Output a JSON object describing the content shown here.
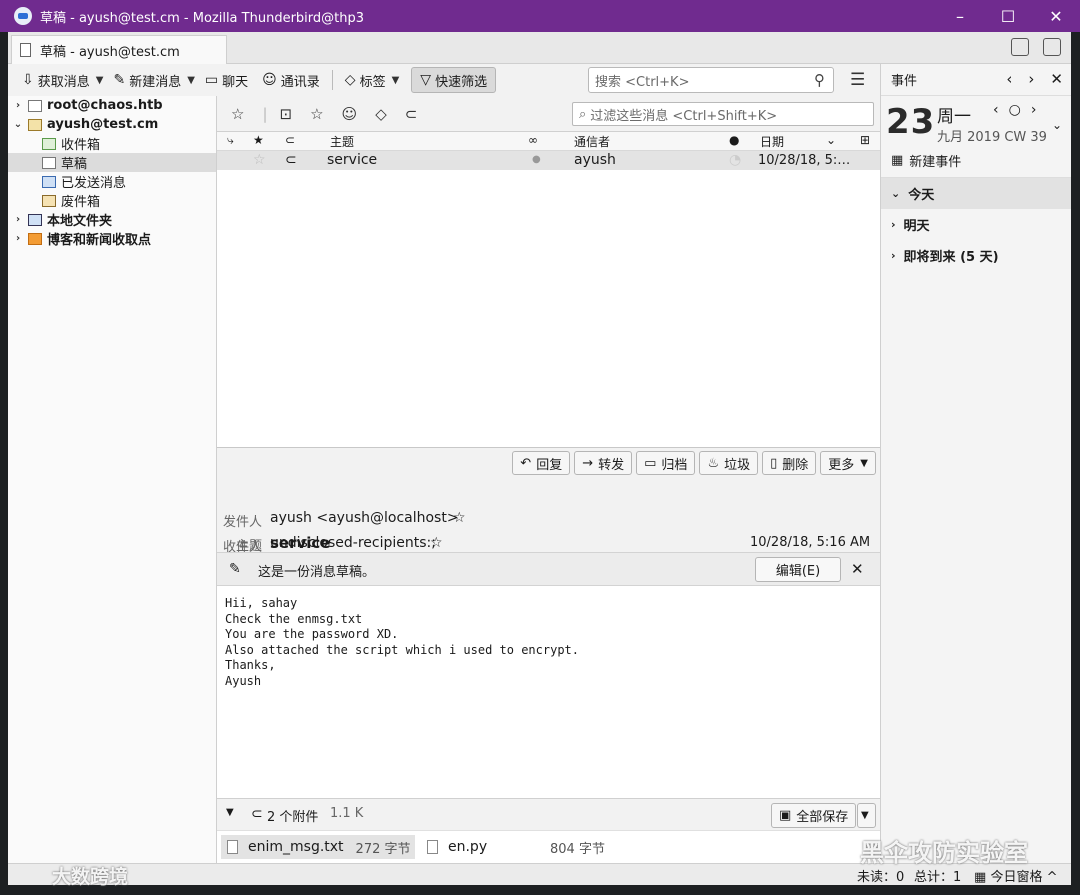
{
  "window": {
    "title": "草稿 - ayush@test.cm - Mozilla Thunderbird@thp3",
    "controls": [
      "–",
      "☐",
      "✕"
    ]
  },
  "tab": {
    "label": "草稿 - ayush@test.cm"
  },
  "toolbar": {
    "get_messages": "获取消息",
    "write": "新建消息",
    "chat": "聊天",
    "address_book": "通讯录",
    "tag": "标签",
    "quick_filter": "快速筛选",
    "search_placeholder": "搜索 <Ctrl+K>"
  },
  "folders": {
    "account1": "root@chaos.htb",
    "account2": "ayush@test.cm",
    "inbox": "收件箱",
    "drafts": "草稿",
    "sent": "已发送消息",
    "trash": "废件箱",
    "local": "本地文件夹",
    "feeds": "博客和新闻收取点"
  },
  "thread": {
    "filter_placeholder": "过滤这些消息 <Ctrl+Shift+K>",
    "columns": {
      "subject": "主题",
      "correspondent": "通信者",
      "date": "日期"
    },
    "rows": [
      {
        "subject": "service",
        "correspondent": "ayush",
        "date": "10/28/18, 5:…"
      }
    ]
  },
  "header": {
    "actions": {
      "reply": "回复",
      "forward": "转发",
      "archive": "归档",
      "junk": "垃圾",
      "delete": "删除",
      "more": "更多"
    },
    "from_label": "发件人",
    "from_value": "ayush <ayush@localhost>",
    "subject_label": "主题",
    "subject_value": "service",
    "date_value": "10/28/18, 5:16 AM",
    "to_label": "收件人",
    "to_value": "undisclosed-recipients:;"
  },
  "draft_notice": {
    "text": "这是一份消息草稿。",
    "edit_button": "编辑(E)"
  },
  "body": {
    "lines": [
      "Hii, sahay",
      "Check the enmsg.txt",
      "You are the password XD.",
      "Also attached the script which i used to encrypt.",
      "Thanks,",
      "Ayush"
    ]
  },
  "attachments": {
    "summary": "2 个附件",
    "size": "1.1 K",
    "save_all": "全部保存",
    "files": [
      {
        "name": "enim_msg.txt",
        "size": "272 字节"
      },
      {
        "name": "en.py",
        "size": "804 字节"
      }
    ]
  },
  "today_pane": {
    "title": "事件",
    "day_number": "23",
    "weekday": "周一",
    "month_line": "九月 2019 CW 39",
    "new_event": "新建事件",
    "today": "今天",
    "tomorrow": "明天",
    "upcoming": "即将到来 (5 天)"
  },
  "status": {
    "unread": "未读：0",
    "total": "总计：1",
    "today_pane": "今日窗格"
  },
  "watermarks": {
    "left": "大数跨境",
    "right": "黑伞攻防实验室"
  }
}
